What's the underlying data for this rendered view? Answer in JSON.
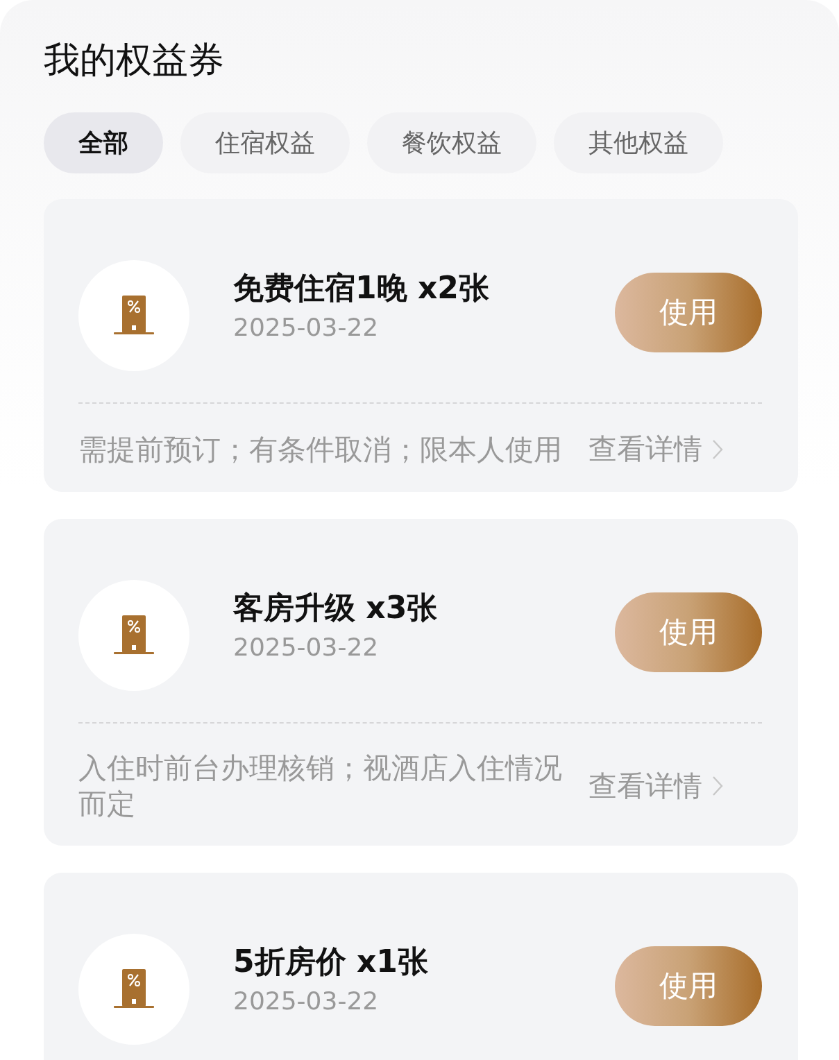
{
  "title": "我的权益券",
  "tabs": [
    {
      "label": "全部",
      "selected": true
    },
    {
      "label": "住宿权益",
      "selected": false
    },
    {
      "label": "餐饮权益",
      "selected": false
    },
    {
      "label": "其他权益",
      "selected": false
    }
  ],
  "coupons": [
    {
      "name": "免费住宿1晚 x2张",
      "date": "2025-03-22",
      "button": "使用",
      "note": "需提前预订；有条件取消；限本人使用",
      "details": "查看详情"
    },
    {
      "name": "客房升级 x3张",
      "date": "2025-03-22",
      "button": "使用",
      "note": "入住时前台办理核销；视酒店入住情况而定",
      "details": "查看详情"
    },
    {
      "name": "5折房价 x1张",
      "date": "2025-03-22",
      "button": "使用"
    }
  ]
}
